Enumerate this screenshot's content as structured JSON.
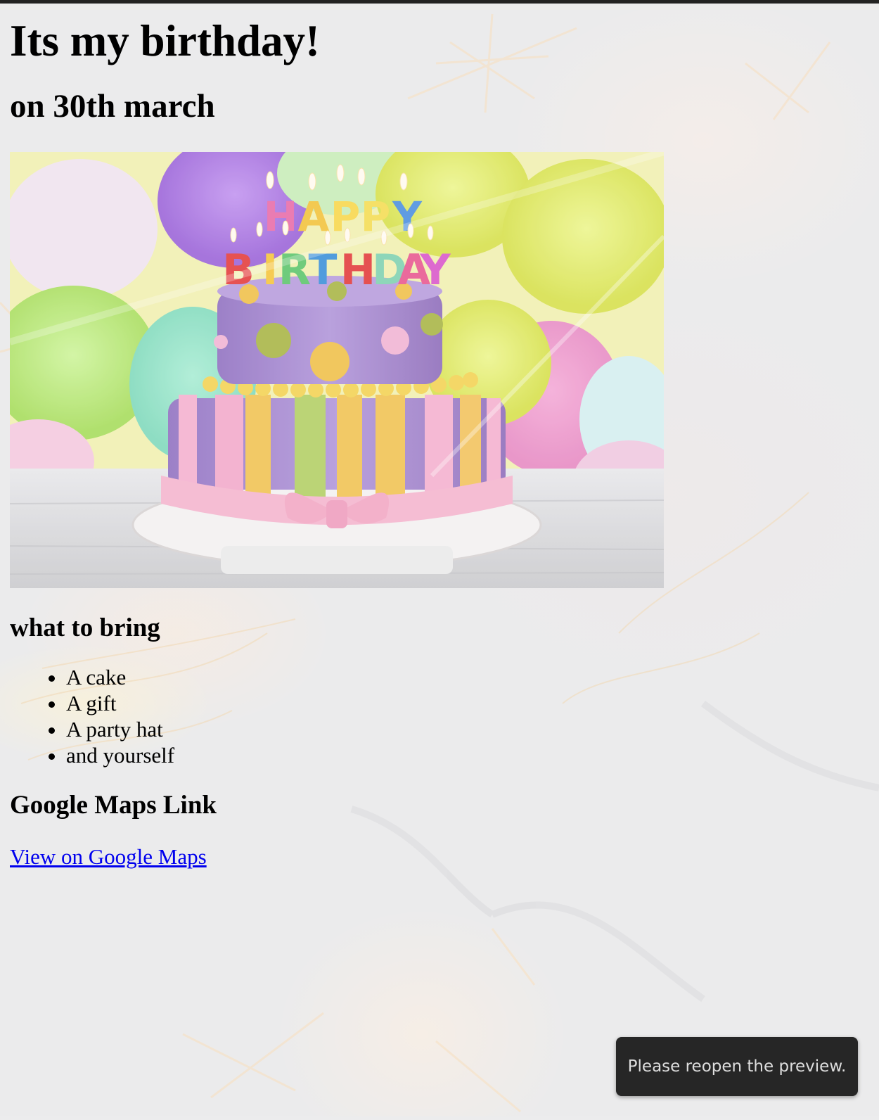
{
  "page": {
    "title": "Its my birthday!",
    "date": "on 30th march"
  },
  "photo": {
    "candle_row1": [
      "H",
      "A",
      "P",
      "P",
      "Y"
    ],
    "candle_row2": [
      "B",
      "I",
      "R",
      "T",
      "H",
      "D",
      "A",
      "Y"
    ],
    "candle_colors_row1": [
      "#e86aa8",
      "#f2c23a",
      "#f7d64a",
      "#f4dc52",
      "#4a8fde"
    ],
    "candle_colors_row2": [
      "#e33b3b",
      "#f5c43a",
      "#5cc46a",
      "#3a8fd9",
      "#e23a3a",
      "#7fd1b0",
      "#e8568f",
      "#d956c9"
    ]
  },
  "bring": {
    "heading": "what to bring",
    "items": [
      "A cake",
      "A gift",
      "A party hat",
      "and yourself"
    ]
  },
  "maps": {
    "heading": "Google Maps Link",
    "link_text": "View on Google Maps"
  },
  "toast": {
    "message": "Please reopen the preview."
  }
}
